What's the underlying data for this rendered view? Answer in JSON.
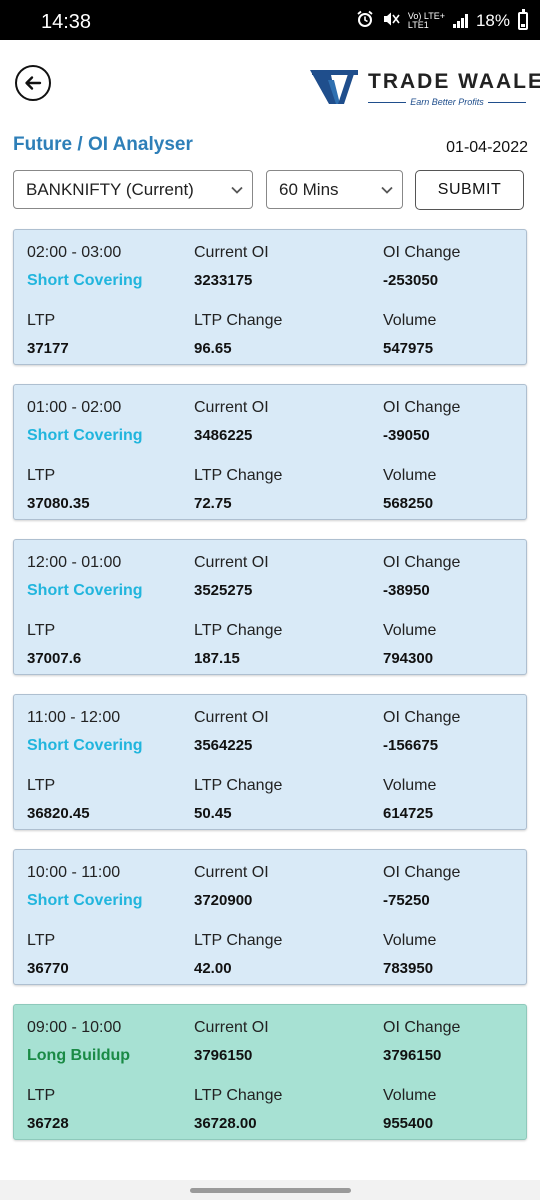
{
  "status_bar": {
    "time": "14:38",
    "network_top": "Vo) LTE+",
    "network_bottom": "LTE1",
    "battery": "18%",
    "icons": [
      "alarm-icon",
      "mute-icon",
      "signal-icon",
      "battery-icon"
    ]
  },
  "header": {
    "back_icon": "arrow-left-circle-icon",
    "brand_name": "TRADE WAALE",
    "brand_tagline": "Earn Better Profits",
    "brand_color": "#1f4e8c"
  },
  "page": {
    "title": "Future / OI Analyser",
    "date": "01-04-2022",
    "title_color": "#2e7fb8"
  },
  "filters": {
    "symbol_selected": "BANKNIFTY (Current)",
    "interval_selected": "60 Mins",
    "submit_label": "SUBMIT"
  },
  "labels": {
    "current_oi": "Current OI",
    "oi_change": "OI Change",
    "ltp": "LTP",
    "ltp_change": "LTP Change",
    "volume": "Volume"
  },
  "colors": {
    "card_blue": "#d9eaf7",
    "card_green": "#a7e1d3",
    "signal_short_covering": "#21b5dd",
    "signal_long_buildup": "#1a8a45"
  },
  "rows": [
    {
      "time": "02:00 - 03:00",
      "signal": "Short Covering",
      "current_oi": "3233175",
      "oi_change": "-253050",
      "ltp": "37177",
      "ltp_change": "96.65",
      "volume": "547975"
    },
    {
      "time": "01:00 - 02:00",
      "signal": "Short Covering",
      "current_oi": "3486225",
      "oi_change": "-39050",
      "ltp": "37080.35",
      "ltp_change": "72.75",
      "volume": "568250"
    },
    {
      "time": "12:00 - 01:00",
      "signal": "Short Covering",
      "current_oi": "3525275",
      "oi_change": "-38950",
      "ltp": "37007.6",
      "ltp_change": "187.15",
      "volume": "794300"
    },
    {
      "time": "11:00 - 12:00",
      "signal": "Short Covering",
      "current_oi": "3564225",
      "oi_change": "-156675",
      "ltp": "36820.45",
      "ltp_change": "50.45",
      "volume": "614725"
    },
    {
      "time": "10:00 - 11:00",
      "signal": "Short Covering",
      "current_oi": "3720900",
      "oi_change": "-75250",
      "ltp": "36770",
      "ltp_change": "42.00",
      "volume": "783950"
    },
    {
      "time": "09:00 - 10:00",
      "signal": "Long Buildup",
      "current_oi": "3796150",
      "oi_change": "3796150",
      "ltp": "36728",
      "ltp_change": "36728.00",
      "volume": "955400"
    }
  ]
}
